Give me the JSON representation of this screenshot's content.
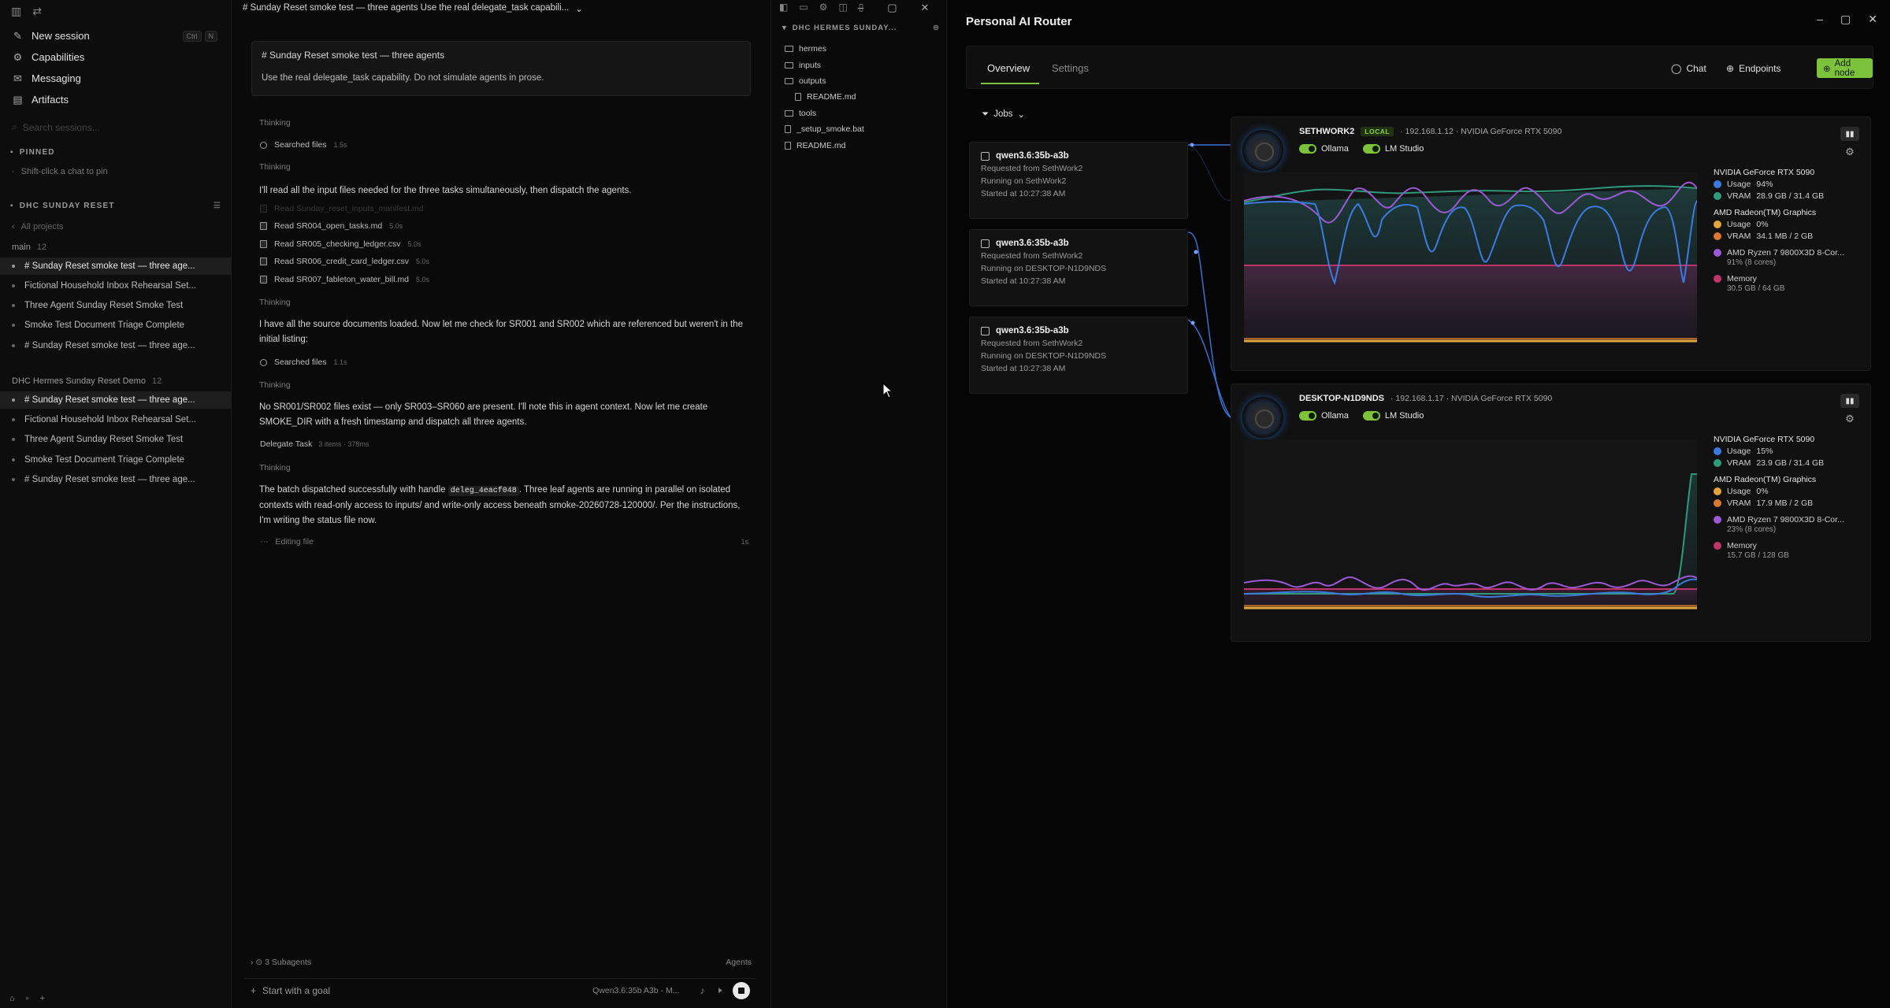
{
  "left_app": {
    "sidebar": {
      "nav": [
        {
          "label": "New session",
          "shortcut": [
            "Ctrl",
            "N"
          ]
        },
        {
          "label": "Capabilities"
        },
        {
          "label": "Messaging"
        },
        {
          "label": "Artifacts"
        }
      ],
      "search_placeholder": "Search sessions...",
      "pinned_header": "PINNED",
      "pinned_hint": "Shift-click a chat to pin",
      "project_header": "DHC SUNDAY RESET",
      "all_projects": "All projects",
      "group1": {
        "name": "main",
        "count": "12"
      },
      "group1_sessions": [
        "# Sunday Reset smoke test — three age...",
        "Fictional Household Inbox Rehearsal Set...",
        "Three Agent Sunday Reset Smoke Test",
        "Smoke Test Document Triage Complete",
        "# Sunday Reset smoke test — three age..."
      ],
      "group2": {
        "name": "DHC Hermes Sunday Reset Demo",
        "count": "12"
      },
      "group2_sessions": [
        "# Sunday Reset smoke test — three age...",
        "Fictional Household Inbox Rehearsal Set...",
        "Three Agent Sunday Reset Smoke Test",
        "Smoke Test Document Triage Complete",
        "# Sunday Reset smoke test — three age..."
      ]
    },
    "chat": {
      "title": "# Sunday Reset smoke test — three agents Use the real delegate_task capabili...",
      "prompt_title": "# Sunday Reset smoke test — three agents",
      "prompt_body": "Use the real delegate_task capability. Do not simulate agents in prose.",
      "thinking_label": "Thinking",
      "searched_files_1": {
        "label": "Searched files",
        "time": "1.5s"
      },
      "msg1": "I'll read all the input files needed for the three tasks simultaneously, then dispatch the agents.",
      "faded_read": "Read Sunday_reset_inputs_manifest.md",
      "reads": [
        {
          "label": "Read SR004_open_tasks.md",
          "time": "5.0s"
        },
        {
          "label": "Read SR005_checking_ledger.csv",
          "time": "5.0s"
        },
        {
          "label": "Read SR006_credit_card_ledger.csv",
          "time": "5.0s"
        },
        {
          "label": "Read SR007_fableton_water_bill.md",
          "time": "5.0s"
        }
      ],
      "msg2": "I have all the source documents loaded. Now let me check for SR001 and SR002 which are referenced but weren't in the initial listing:",
      "searched_files_2": {
        "label": "Searched files",
        "time": "1.1s"
      },
      "msg3": "No SR001/SR002 files exist — only SR003–SR060 are present. I'll note this in agent context. Now let me create SMOKE_DIR with a fresh timestamp and dispatch all three agents.",
      "delegate": {
        "label": "Delegate Task",
        "meta": "3 items · 378ms"
      },
      "msg4_pre": "The batch dispatched successfully with handle ",
      "msg4_code": "deleg_4eacf048",
      "msg4_post": ". Three leaf agents are running in parallel on isolated contexts with read-only access to inputs/ and write-only access beneath smoke-20260728-120000/. Per the instructions, I'm writing the status file now.",
      "editing": {
        "label": "Editing file",
        "time": "1s"
      },
      "subagents": "3 Subagents",
      "agents_label": "Agents",
      "composer_placeholder": "Start with a goal",
      "model": "Qwen3.6:35b A3b - M..."
    },
    "files": {
      "header": "DHC HERMES SUNDAY...",
      "tree": [
        {
          "name": "hermes",
          "type": "folder",
          "depth": 0
        },
        {
          "name": "inputs",
          "type": "folder",
          "depth": 0
        },
        {
          "name": "outputs",
          "type": "folder",
          "depth": 0
        },
        {
          "name": "README.md",
          "type": "file",
          "depth": 1
        },
        {
          "name": "tools",
          "type": "folder",
          "depth": 0
        },
        {
          "name": "_setup_smoke.bat",
          "type": "file",
          "depth": 0
        },
        {
          "name": "README.md",
          "type": "file",
          "depth": 0
        }
      ]
    }
  },
  "right_app": {
    "title": "Personal AI Router",
    "tabs": [
      "Overview",
      "Settings"
    ],
    "buttons": {
      "chat": "Chat",
      "endpoints": "Endpoints",
      "add_node": "Add node"
    },
    "jobs_label": "Jobs",
    "jobs": [
      {
        "model": "qwen3.6:35b-a3b",
        "requested": "Requested from SethWork2",
        "running": "Running on SethWork2",
        "started": "Started at 10:27:38 AM"
      },
      {
        "model": "qwen3.6:35b-a3b",
        "requested": "Requested from SethWork2",
        "running": "Running on DESKTOP-N1D9NDS",
        "started": "Started at 10:27:38 AM"
      },
      {
        "model": "qwen3.6:35b-a3b",
        "requested": "Requested from SethWork2",
        "running": "Running on DESKTOP-N1D9NDS",
        "started": "Started at 10:27:38 AM"
      }
    ],
    "nodes": [
      {
        "name": "SETHWORK2",
        "badge": "LOCAL",
        "info": "· 192.168.1.12 · NVIDIA GeForce RTX 5090",
        "toggles": [
          "Ollama",
          "LM Studio"
        ],
        "legend": [
          {
            "header": "NVIDIA GeForce RTX 5090",
            "rows": [
              {
                "label": "Usage",
                "value": "94%",
                "color": "#3b7be0"
              },
              {
                "label": "VRAM",
                "value": "28.9 GB / 31.4 GB",
                "color": "#2e9a7a"
              }
            ]
          },
          {
            "header": "AMD Radeon(TM) Graphics",
            "rows": [
              {
                "label": "Usage",
                "value": "0%",
                "color": "#e2a53a"
              },
              {
                "label": "VRAM",
                "value": "34.1 MB / 2 GB",
                "color": "#d9782e"
              }
            ]
          },
          {
            "header": "",
            "rows": [
              {
                "label": "AMD Ryzen 7 9800X3D 8-Cor...",
                "value": "",
                "color": "#9b59d6"
              }
            ],
            "sub": "91% (8 cores)"
          },
          {
            "header": "",
            "rows": [
              {
                "label": "Memory",
                "value": "",
                "color": "#c0336b"
              }
            ],
            "sub": "30.5 GB / 64 GB"
          }
        ]
      },
      {
        "name": "DESKTOP-N1D9NDS",
        "badge": "",
        "info": "· 192.168.1.17 · NVIDIA GeForce RTX 5090",
        "toggles": [
          "Ollama",
          "LM Studio"
        ],
        "legend": [
          {
            "header": "NVIDIA GeForce RTX 5090",
            "rows": [
              {
                "label": "Usage",
                "value": "15%",
                "color": "#3b7be0"
              },
              {
                "label": "VRAM",
                "value": "23.9 GB / 31.4 GB",
                "color": "#2e9a7a"
              }
            ]
          },
          {
            "header": "AMD Radeon(TM) Graphics",
            "rows": [
              {
                "label": "Usage",
                "value": "0%",
                "color": "#e2a53a"
              },
              {
                "label": "VRAM",
                "value": "17.9 MB / 2 GB",
                "color": "#d9782e"
              }
            ]
          },
          {
            "header": "",
            "rows": [
              {
                "label": "AMD Ryzen 7 9800X3D 8-Cor...",
                "value": "",
                "color": "#9b59d6"
              }
            ],
            "sub": "23% (8 cores)"
          },
          {
            "header": "",
            "rows": [
              {
                "label": "Memory",
                "value": "",
                "color": "#c0336b"
              }
            ],
            "sub": "15.7 GB / 128 GB"
          }
        ]
      }
    ]
  }
}
